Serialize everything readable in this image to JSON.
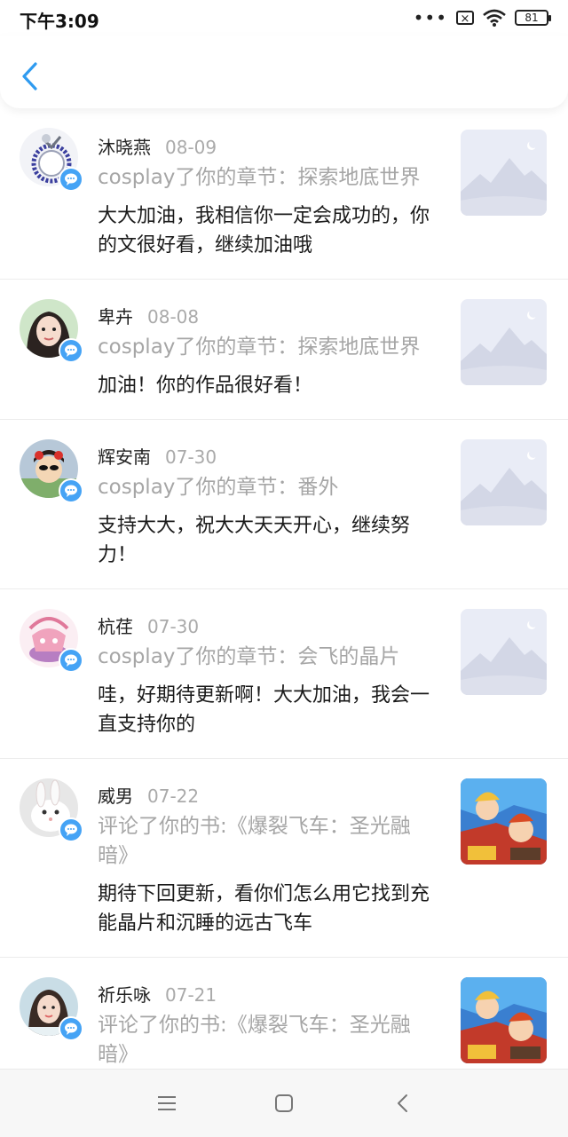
{
  "status_bar": {
    "time": "下午3:09",
    "signal_dots": "•••",
    "sim_icon": "sim-x-icon",
    "battery_level": "81"
  },
  "header": {
    "back_icon": "chevron-left-icon"
  },
  "messages": [
    {
      "name": "沐晓燕",
      "date": "08-09",
      "context": "cosplay了你的章节：探索地底世界",
      "comment": "大大加油，我相信你一定会成功的，你的文很好看，继续加油哦",
      "thumbnail": "placeholder-mountain-image"
    },
    {
      "name": "卑卉",
      "date": "08-08",
      "context": "cosplay了你的章节：探索地底世界",
      "comment": "加油！你的作品很好看！",
      "thumbnail": "placeholder-mountain-image"
    },
    {
      "name": "辉安南",
      "date": "07-30",
      "context": "cosplay了你的章节：番外",
      "comment": "支持大大，祝大大天天开心，继续努力！",
      "thumbnail": "placeholder-mountain-image"
    },
    {
      "name": "杭荏",
      "date": "07-30",
      "context": "cosplay了你的章节：会飞的晶片",
      "comment": "哇，好期待更新啊！大大加油，我会一直支持你的",
      "thumbnail": "placeholder-mountain-image"
    },
    {
      "name": "威男",
      "date": "07-22",
      "context": "评论了你的书:《爆裂飞车：圣光融暗》",
      "comment": "期待下回更新，看你们怎么用它找到充能晶片和沉睡的远古飞车",
      "thumbnail": "book-cover-image"
    },
    {
      "name": "祈乐咏",
      "date": "07-21",
      "context": "评论了你的书:《爆裂飞车：圣光融暗》",
      "comment": "",
      "thumbnail": "book-cover-image"
    }
  ],
  "nav_bar": {
    "menu_icon": "menu-icon",
    "home_icon": "home-square-icon",
    "back_icon": "back-triangle-icon"
  },
  "colors": {
    "accent": "#45a3f5",
    "muted_text": "#a6a6a6",
    "divider": "#ececec"
  }
}
